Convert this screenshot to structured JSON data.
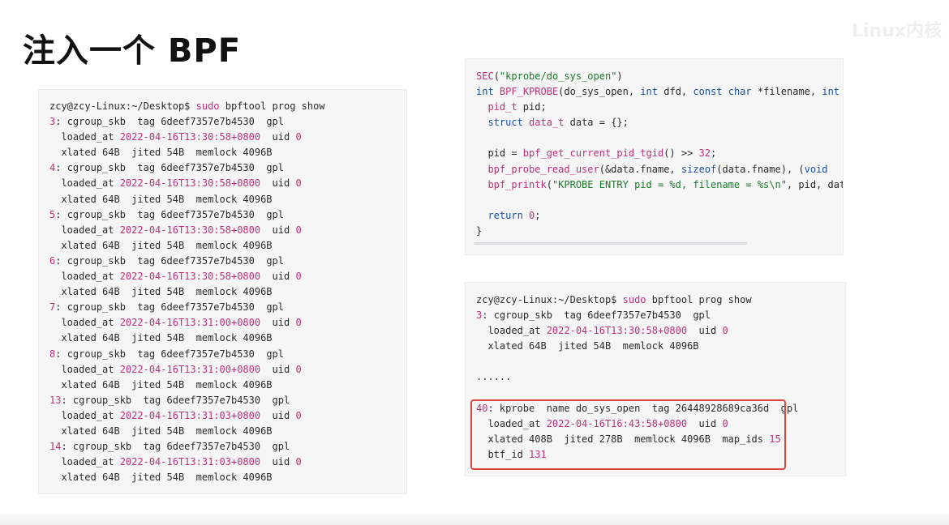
{
  "slide": {
    "title": "注入一个 BPF",
    "watermark": "Linux内核"
  },
  "left_terminal": {
    "prompt": "zcy@zcy-Linux:~/Desktop$",
    "command": "sudo",
    "command_rest": " bpftool prog show",
    "entries": [
      {
        "id": "3",
        "head": " cgroup_skb  tag 6deef7357e7b4530  gpl",
        "loaded": "2022-04-16T13:30:58+0800",
        "uid": "0",
        "xlated": "  xlated 64B  jited 54B  memlock 4096B"
      },
      {
        "id": "4",
        "head": " cgroup_skb  tag 6deef7357e7b4530  gpl",
        "loaded": "2022-04-16T13:30:58+0800",
        "uid": "0",
        "xlated": "  xlated 64B  jited 54B  memlock 4096B"
      },
      {
        "id": "5",
        "head": " cgroup_skb  tag 6deef7357e7b4530  gpl",
        "loaded": "2022-04-16T13:30:58+0800",
        "uid": "0",
        "xlated": "  xlated 64B  jited 54B  memlock 4096B"
      },
      {
        "id": "6",
        "head": " cgroup_skb  tag 6deef7357e7b4530  gpl",
        "loaded": "2022-04-16T13:30:58+0800",
        "uid": "0",
        "xlated": "  xlated 64B  jited 54B  memlock 4096B"
      },
      {
        "id": "7",
        "head": " cgroup_skb  tag 6deef7357e7b4530  gpl",
        "loaded": "2022-04-16T13:31:00+0800",
        "uid": "0",
        "xlated": "  xlated 64B  jited 54B  memlock 4096B"
      },
      {
        "id": "8",
        "head": " cgroup_skb  tag 6deef7357e7b4530  gpl",
        "loaded": "2022-04-16T13:31:00+0800",
        "uid": "0",
        "xlated": "  xlated 64B  jited 54B  memlock 4096B"
      },
      {
        "id": "13",
        "head": " cgroup_skb  tag 6deef7357e7b4530  gpl",
        "loaded": "2022-04-16T13:31:03+0800",
        "uid": "0",
        "xlated": "  xlated 64B  jited 54B  memlock 4096B"
      },
      {
        "id": "14",
        "head": " cgroup_skb  tag 6deef7357e7b4530  gpl",
        "loaded": "2022-04-16T13:31:03+0800",
        "uid": "0",
        "xlated": "  xlated 64B  jited 54B  memlock 4096B"
      }
    ]
  },
  "code_panel": {
    "lines": [
      "SEC(\"kprobe/do_sys_open\")",
      "int BPF_KPROBE(do_sys_open, int dfd, const char *filename, int f",
      "  pid_t pid;",
      "  struct data_t data = {};",
      "",
      "  pid = bpf_get_current_pid_tgid() >> 32;",
      "  bpf_probe_read_user(&data.fname, sizeof(data.fname), (void",
      "  bpf_printk(\"KPROBE ENTRY pid = %d, filename = %s\\n\", pid, data",
      "",
      "  return 0;",
      "}"
    ]
  },
  "right_terminal": {
    "prompt": "zcy@zcy-Linux:~/Desktop$",
    "command": "sudo",
    "command_rest": " bpftool prog show",
    "entry": {
      "id": "3",
      "head": " cgroup_skb  tag 6deef7357e7b4530  gpl",
      "loaded": "2022-04-16T13:30:58+0800",
      "uid": "0",
      "xlated": "  xlated 64B  jited 54B  memlock 4096B"
    },
    "ellipsis": "......",
    "highlight": {
      "id": "40",
      "head": ": kprobe  name do_sys_open  tag 26448928689ca36d  gpl",
      "loaded": "2022-04-16T16:43:58+0800",
      "uid": "0",
      "xlated_pre": "  xlated 408B  jited 278B  memlock 4096B  map_ids ",
      "map_ids": "15",
      "btf_pre": "  btf_id ",
      "btf_id": "131"
    }
  }
}
